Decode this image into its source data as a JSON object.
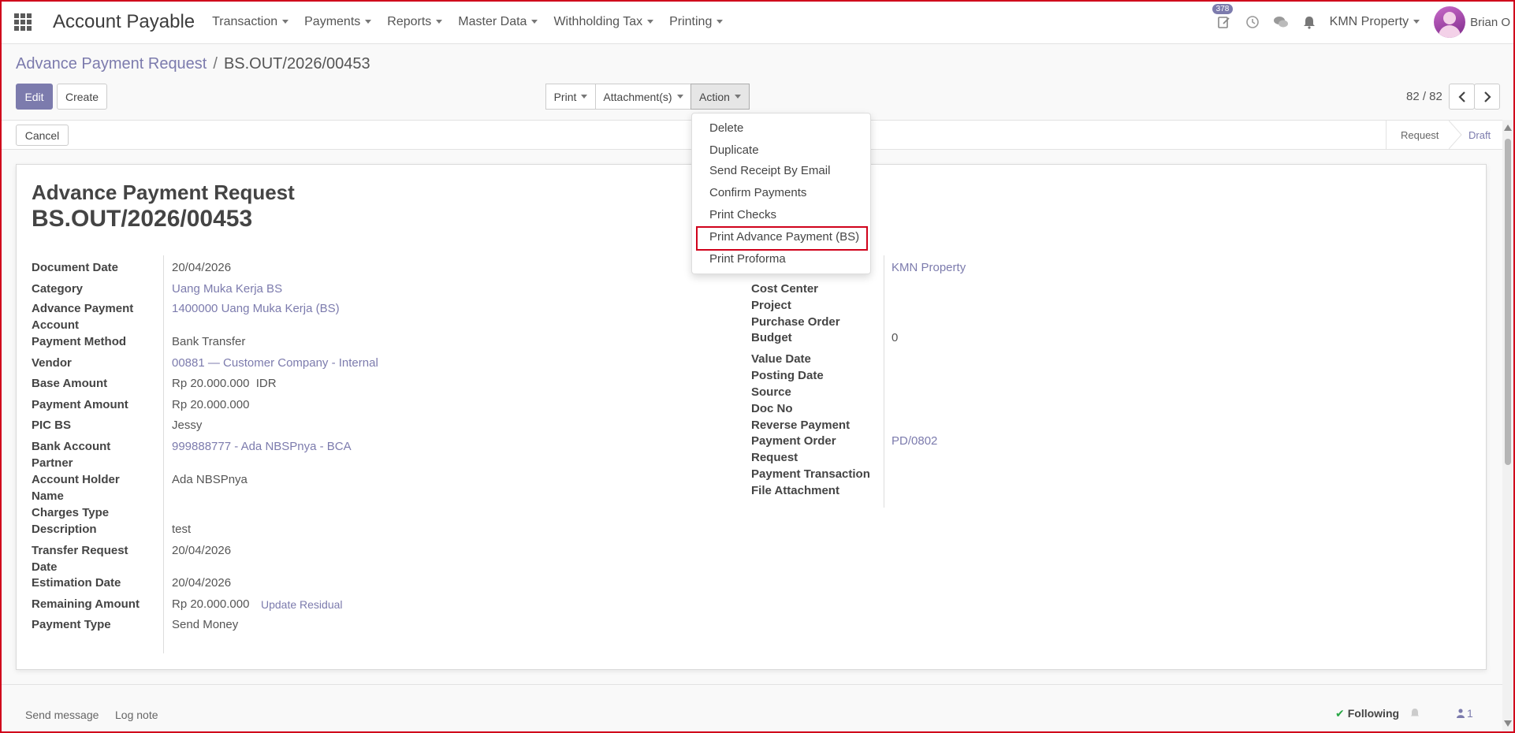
{
  "navbar": {
    "app_title": "Account Payable",
    "menu": [
      "Transaction",
      "Payments",
      "Reports",
      "Master Data",
      "Withholding Tax",
      "Printing"
    ],
    "activity_badge": "378",
    "company": "KMN Property",
    "user": "Brian O"
  },
  "breadcrumb": {
    "parent": "Advance Payment Request",
    "separator": "/",
    "current": "BS.OUT/2026/00453"
  },
  "buttons": {
    "edit": "Edit",
    "create": "Create",
    "print": "Print",
    "attachments": "Attachment(s)",
    "action": "Action",
    "cancel": "Cancel"
  },
  "pager": {
    "value": "82 / 82"
  },
  "status": {
    "stages": [
      "Request",
      "Draft"
    ],
    "active": "Draft"
  },
  "form": {
    "title": "Advance Payment Request",
    "number": "BS.OUT/2026/00453",
    "left": {
      "document_date": {
        "label": "Document Date",
        "value": "20/04/2026"
      },
      "category": {
        "label": "Category",
        "value": "Uang Muka Kerja BS"
      },
      "adv_account": {
        "label1": "Advance Payment",
        "label2": "Account",
        "value": "1400000 Uang Muka Kerja (BS)"
      },
      "payment_method": {
        "label": "Payment Method",
        "value": "Bank Transfer"
      },
      "vendor": {
        "label": "Vendor",
        "value": "00881 — Customer Company - Internal"
      },
      "base_amount": {
        "label": "Base Amount",
        "value": "Rp 20.000.000",
        "currency": "IDR"
      },
      "payment_amount": {
        "label": "Payment Amount",
        "value": "Rp 20.000.000"
      },
      "pic_bs": {
        "label": "PIC BS",
        "value": "Jessy"
      },
      "bank_account": {
        "label1": "Bank Account",
        "label2": "Partner",
        "value": "999888777 - Ada NBSPnya - BCA"
      },
      "account_holder": {
        "label1": "Account Holder",
        "label2": "Name",
        "value": "Ada NBSPnya"
      },
      "charges_type": {
        "label": "Charges Type",
        "value": ""
      },
      "description": {
        "label": "Description",
        "value": "test"
      },
      "transfer_date": {
        "label1": "Transfer Request",
        "label2": "Date",
        "value": "20/04/2026"
      },
      "estimation_date": {
        "label": "Estimation Date",
        "value": "20/04/2026"
      },
      "remaining_amount": {
        "label": "Remaining Amount",
        "value": "Rp 20.000.000",
        "action": "Update Residual"
      },
      "payment_type": {
        "label": "Payment Type",
        "value": "Send Money"
      }
    },
    "right": {
      "company_value": "KMN Property",
      "cost_center": "Cost Center",
      "project": "Project",
      "purchase_order": "Purchase Order",
      "budget": {
        "label": "Budget",
        "value": "0"
      },
      "value_date": "Value Date",
      "posting_date": "Posting Date",
      "source": "Source",
      "doc_no": "Doc No",
      "reverse_payment": "Reverse Payment",
      "payment_order": {
        "label1": "Payment Order",
        "label2": "Request",
        "value": "PD/0802"
      },
      "payment_transaction": "Payment Transaction",
      "file_attachment": "File Attachment"
    }
  },
  "action_menu": {
    "items": [
      "Delete",
      "Duplicate",
      "Send Receipt By Email",
      "Confirm Payments",
      "Print Checks",
      "Print Advance Payment (BS)",
      "Print Proforma"
    ],
    "highlighted": "Print Advance Payment (BS)"
  },
  "chatter": {
    "send_message": "Send message",
    "log_note": "Log note",
    "following": "Following",
    "followers": "1"
  },
  "colors": {
    "accent": "#7c7bad",
    "highlight_border": "#d0021b"
  }
}
